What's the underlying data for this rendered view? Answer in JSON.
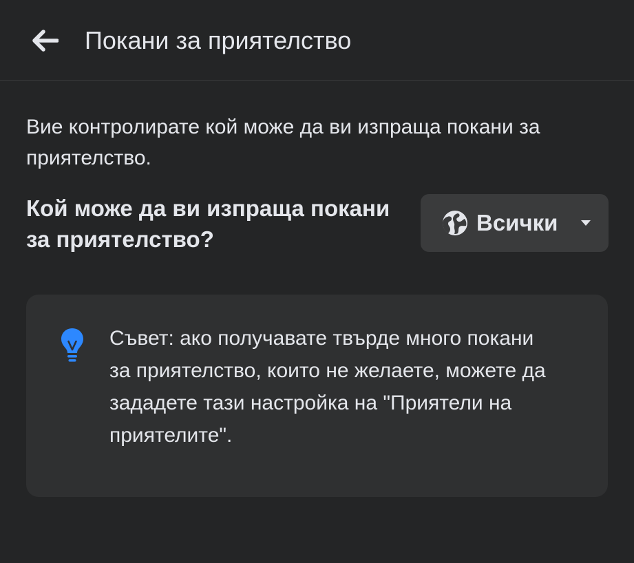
{
  "header": {
    "title": "Покани за приятелство",
    "back_icon": "arrow-left-icon"
  },
  "description": "Вие контролирате кой може да ви изпраща покани за приятелство.",
  "setting": {
    "question": "Кой може да ви изпраща покани за приятелство?",
    "audience": {
      "label": "Всички",
      "icon": "globe-icon",
      "dropdown_icon": "caret-down-icon"
    }
  },
  "tip": {
    "icon": "lightbulb-icon",
    "text": "Съвет: ако получавате твърде много покани за приятелство, които не желаете, можете да зададете тази настройка на \"Приятели на приятелите\"."
  },
  "colors": {
    "background": "#242526",
    "surface": "#3a3b3c",
    "card": "#2f3031",
    "text": "#e4e6eb",
    "accent": "#2d88ff"
  }
}
